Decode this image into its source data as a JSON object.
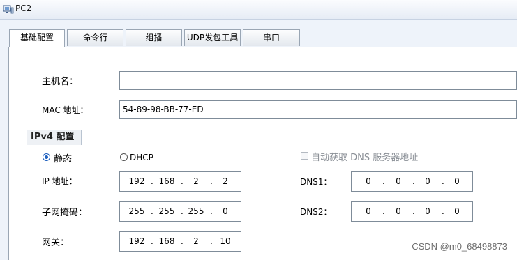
{
  "window": {
    "title": "PC2",
    "icon": "pc-icon"
  },
  "tabs": [
    {
      "label": "基础配置",
      "active": true
    },
    {
      "label": "命令行",
      "active": false
    },
    {
      "label": "组播",
      "active": false
    },
    {
      "label": "UDP发包工具",
      "active": false
    },
    {
      "label": "串口",
      "active": false
    }
  ],
  "basic": {
    "hostname_label": "主机名：",
    "hostname_value": "",
    "mac_label": "MAC 地址：",
    "mac_value": "54-89-98-BB-77-ED"
  },
  "ipv4": {
    "group_title": "IPv4 配置",
    "static_label": "静态",
    "static_selected": true,
    "dhcp_label": "DHCP",
    "auto_dns_label": "自动获取 DNS 服务器地址",
    "auto_dns_checked": false,
    "ip_label": "IP 地址：",
    "ip": [
      "192",
      "168",
      "2",
      "2"
    ],
    "mask_label": "子网掩码：",
    "mask": [
      "255",
      "255",
      "255",
      "0"
    ],
    "gateway_label": "网关：",
    "gateway": [
      "192",
      "168",
      "2",
      "10"
    ],
    "dns1_label": "DNS1：",
    "dns1": [
      "0",
      "0",
      "0",
      "0"
    ],
    "dns2_label": "DNS2：",
    "dns2": [
      "0",
      "0",
      "0",
      "0"
    ]
  },
  "watermark": "CSDN @m0_68498873"
}
